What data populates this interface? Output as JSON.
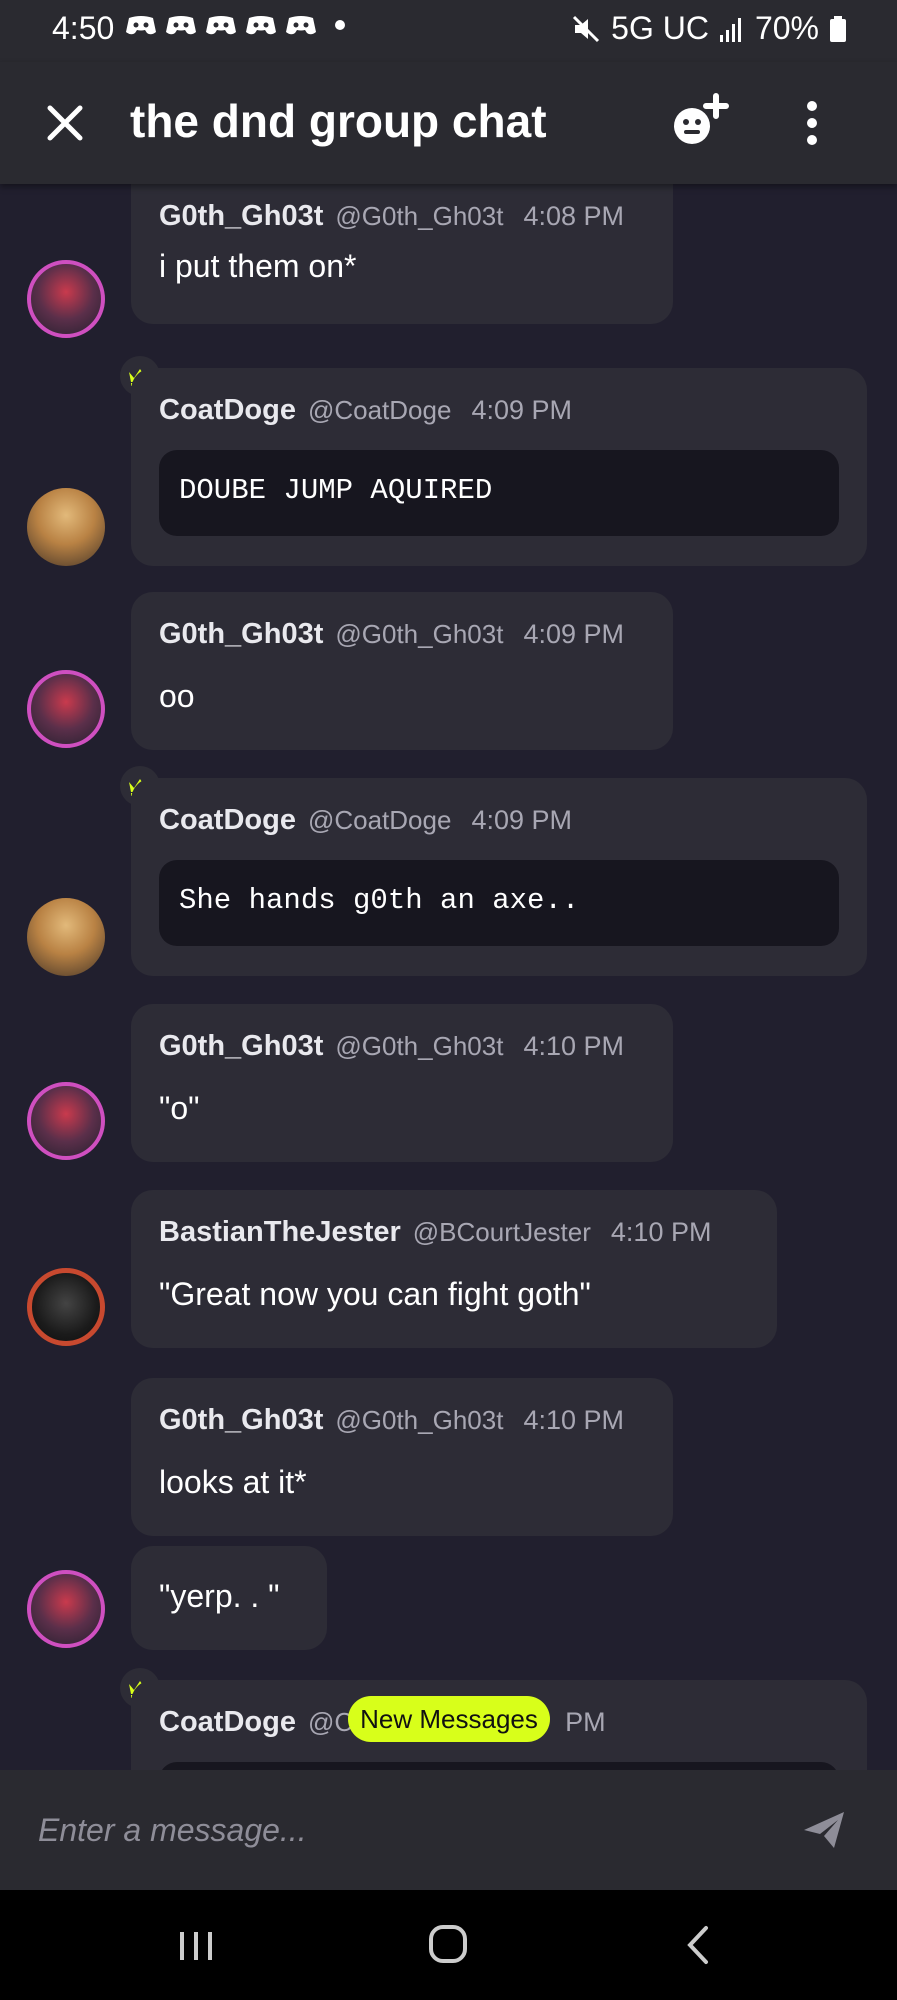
{
  "status_bar": {
    "time": "4:50",
    "network": "5G UC",
    "battery": "70%",
    "icons": [
      "discord-icon",
      "discord-icon",
      "discord-icon",
      "discord-icon",
      "discord-icon",
      "dot-icon",
      "mute-icon",
      "signal-icon",
      "battery-icon"
    ]
  },
  "header": {
    "title": "the dnd group chat",
    "close_icon": "close-icon",
    "add_member_icon": "add-member-icon",
    "more_icon": "more-vertical-icon"
  },
  "messages": [
    {
      "author": "G0th_Gh03t",
      "handle": "@G0th_Gh03t",
      "time": "4:08 PM",
      "text": "i put them on*"
    },
    {
      "author": "CoatDoge",
      "handle": "@CoatDoge",
      "time": "4:09 PM",
      "code": "DOUBE JUMP AQUIRED"
    },
    {
      "author": "G0th_Gh03t",
      "handle": "@G0th_Gh03t",
      "time": "4:09 PM",
      "text": "oo"
    },
    {
      "author": "CoatDoge",
      "handle": "@CoatDoge",
      "time": "4:09 PM",
      "code": "She hands g0th an axe.."
    },
    {
      "author": "G0th_Gh03t",
      "handle": "@G0th_Gh03t",
      "time": "4:10 PM",
      "text": "\"o\""
    },
    {
      "author": "BastianTheJester",
      "handle": "@BCourtJester",
      "time": "4:10 PM",
      "text": "\"Great now you can fight goth\""
    },
    {
      "author": "G0th_Gh03t",
      "handle": "@G0th_Gh03t",
      "time": "4:10 PM",
      "text": "looks at it*",
      "followup": "\"yerp. . \""
    },
    {
      "author": "CoatDoge",
      "handle": "@C",
      "time": "PM"
    }
  ],
  "new_messages_label": "New Messages",
  "composer": {
    "placeholder": "Enter a message...",
    "send_icon": "send-icon"
  },
  "colors": {
    "background": "#211f2e",
    "bubble": "#2d2c36",
    "code_block": "#17161f",
    "accent": "#d8ff1a",
    "avatar_ring_goth": "#cf4fc0"
  }
}
